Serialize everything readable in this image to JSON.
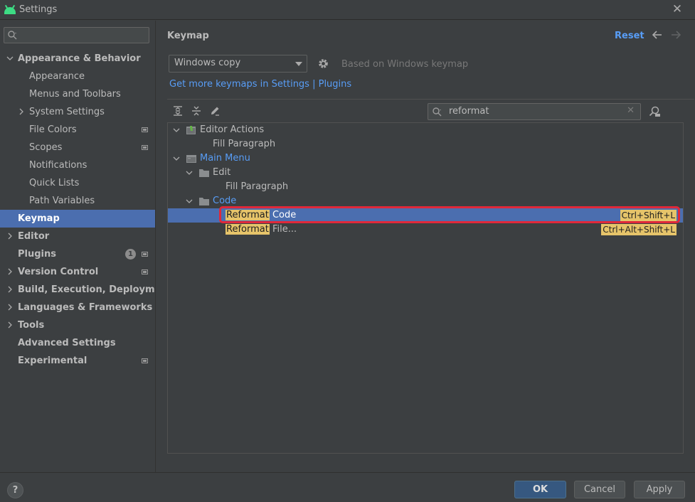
{
  "window": {
    "title": "Settings"
  },
  "sidebar": {
    "search_placeholder": "",
    "items": [
      {
        "label": "Appearance & Behavior",
        "bold": true,
        "expanded": true
      },
      {
        "label": "Appearance"
      },
      {
        "label": "Menus and Toolbars"
      },
      {
        "label": "System Settings",
        "collapsed": true
      },
      {
        "label": "File Colors"
      },
      {
        "label": "Scopes"
      },
      {
        "label": "Notifications"
      },
      {
        "label": "Quick Lists"
      },
      {
        "label": "Path Variables"
      },
      {
        "label": "Keymap",
        "bold": true,
        "selected": true
      },
      {
        "label": "Editor",
        "bold": true,
        "collapsed": true
      },
      {
        "label": "Plugins",
        "bold": true,
        "badge": "1"
      },
      {
        "label": "Version Control",
        "bold": true,
        "collapsed": true
      },
      {
        "label": "Build, Execution, Deployment",
        "bold": true,
        "collapsed": true
      },
      {
        "label": "Languages & Frameworks",
        "bold": true,
        "collapsed": true
      },
      {
        "label": "Tools",
        "bold": true,
        "collapsed": true
      },
      {
        "label": "Advanced Settings",
        "bold": true
      },
      {
        "label": "Experimental",
        "bold": true
      }
    ]
  },
  "main": {
    "title": "Keymap",
    "reset_label": "Reset",
    "keymap_selected": "Windows copy",
    "based_on": "Based on Windows keymap",
    "get_more_link": "Get more keymaps in Settings | Plugins",
    "filter_value": "reformat"
  },
  "keymap_tree": [
    {
      "label": "Editor Actions",
      "expanded": true
    },
    {
      "label": "Fill Paragraph"
    },
    {
      "label": "Main Menu",
      "expanded": true
    },
    {
      "label": "Edit",
      "expanded": true
    },
    {
      "label": "Fill Paragraph"
    },
    {
      "label": "Code",
      "expanded": true
    },
    {
      "highlight": "Reformat",
      "rest": " Code",
      "shortcut": "Ctrl+Shift+L",
      "selected": true
    },
    {
      "highlight": "Reformat",
      "rest": " File...",
      "shortcut": "Ctrl+Alt+Shift+L"
    }
  ],
  "footer": {
    "help_label": "?",
    "ok_label": "OK",
    "cancel_label": "Cancel",
    "apply_label": "Apply"
  },
  "colors": {
    "selection": "#4b6eaf",
    "link": "#589df6",
    "match_highlight": "#e6c46a",
    "annotation_red": "#e0283a"
  }
}
